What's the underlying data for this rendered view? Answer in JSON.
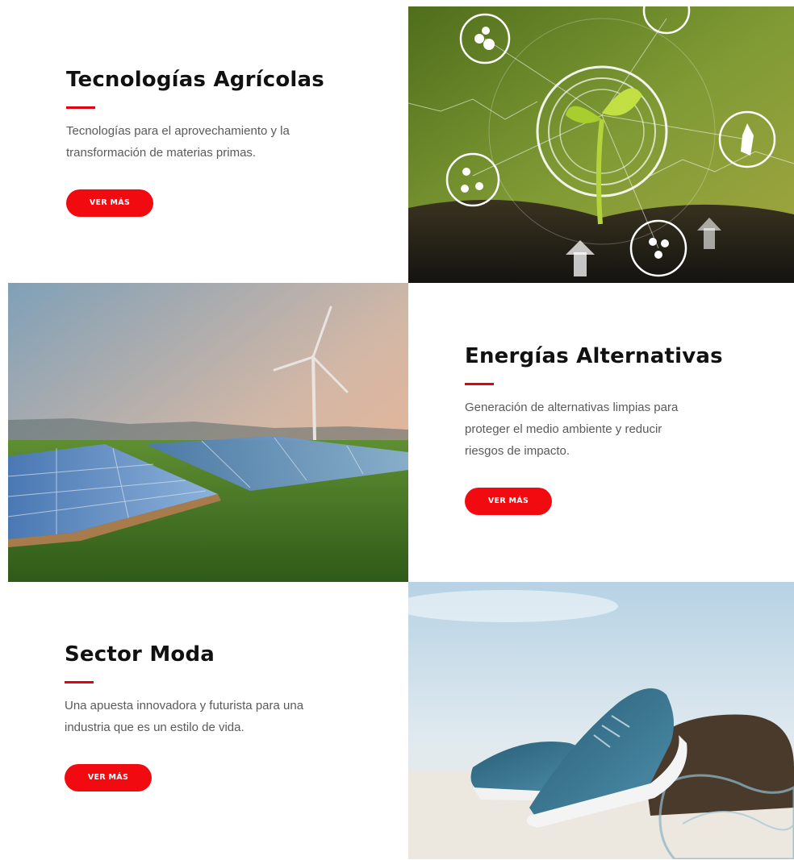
{
  "sections": [
    {
      "title": "Tecnologías Agrícolas",
      "description_lines": [
        "Tecnologías para el aprovechamiento y la",
        "transformación de materias primas."
      ],
      "button_label": "VER MÁS"
    },
    {
      "title": "Energías Alternativas",
      "description_lines": [
        "Generación de alternativas limpias para",
        "proteger el medio ambiente y reducir",
        "riesgos de impacto."
      ],
      "button_label": "VER MÁS"
    },
    {
      "title": "Sector Moda",
      "description_lines": [
        "Una apuesta innovadora y futurista para una",
        "industria que es un estilo de vida."
      ],
      "button_label": "VER MÁS"
    }
  ],
  "images": {
    "agri": "sprout with technology icons",
    "energy": "solar panels and wind turbine",
    "fashion": "sneakers on beach"
  },
  "colors": {
    "accent": "#e3000f",
    "button": "#f10a10",
    "title": "#111111",
    "body_text": "#5a5a5a"
  }
}
